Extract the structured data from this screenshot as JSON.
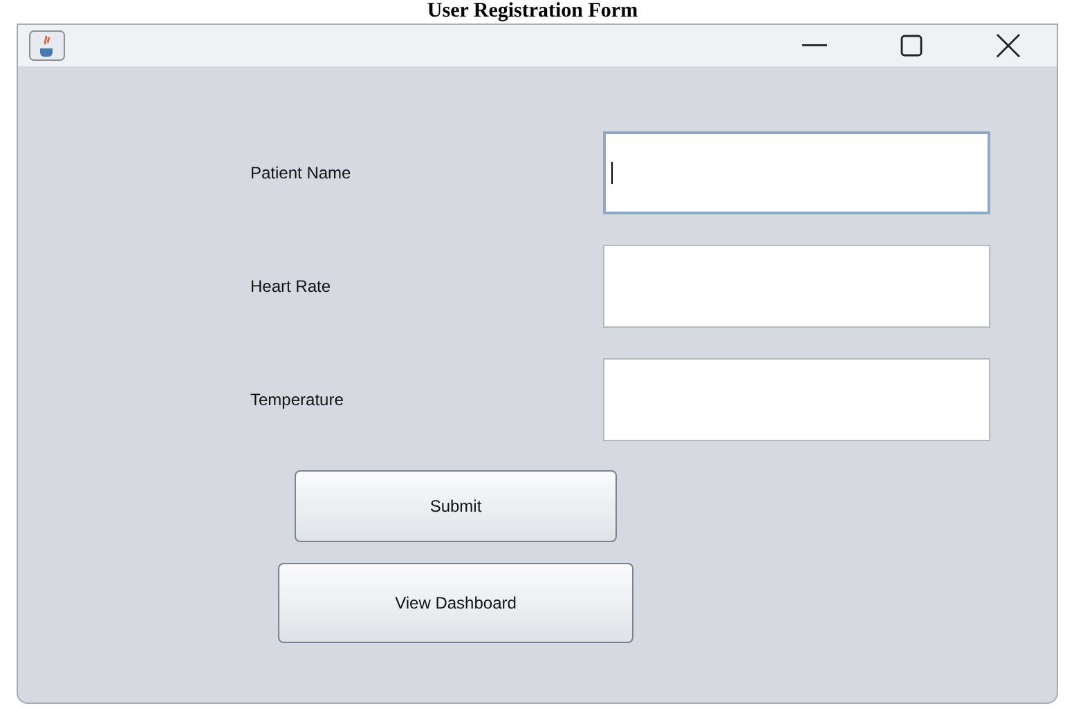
{
  "heading": "User Registration Form",
  "fields": [
    {
      "label": "Patient Name",
      "focused": true
    },
    {
      "label": "Heart Rate",
      "focused": false
    },
    {
      "label": "Temperature",
      "focused": false
    }
  ],
  "buttons": [
    {
      "label": "Submit"
    },
    {
      "label": "View Dashboard"
    }
  ]
}
